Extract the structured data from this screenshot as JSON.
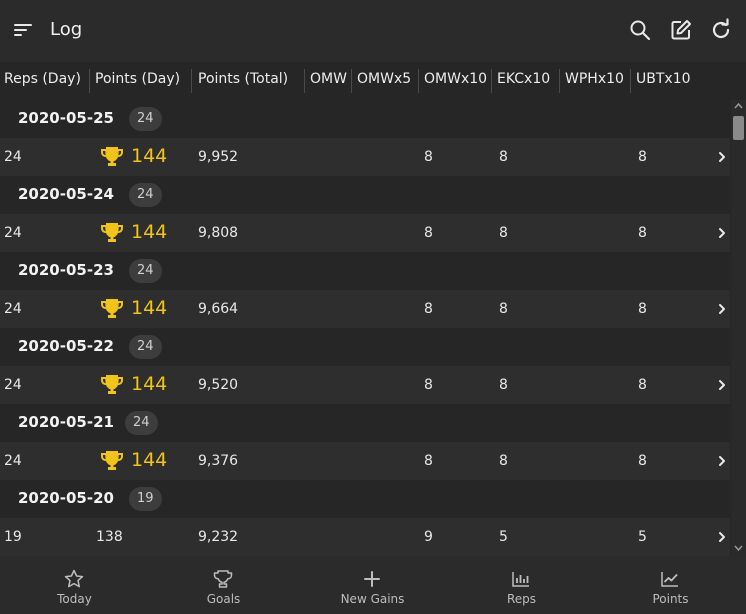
{
  "appbar": {
    "title": "Log",
    "icons": [
      "menu-icon",
      "search-icon",
      "edit-icon",
      "refresh-icon"
    ]
  },
  "columns": [
    "Reps (Day)",
    "Points (Day)",
    "Points (Total)",
    "OMW",
    "OMWx5",
    "OMWx10",
    "EKCx10",
    "WPHx10",
    "UBTx10"
  ],
  "groups": [
    {
      "date": "2020-05-25",
      "count": "24",
      "row": {
        "reps": "24",
        "points_day": "144",
        "trophy": true,
        "points_total": "9,952",
        "omwx10": "8",
        "ekcx10": "8",
        "ubtx10": "8"
      }
    },
    {
      "date": "2020-05-24",
      "count": "24",
      "row": {
        "reps": "24",
        "points_day": "144",
        "trophy": true,
        "points_total": "9,808",
        "omwx10": "8",
        "ekcx10": "8",
        "ubtx10": "8"
      }
    },
    {
      "date": "2020-05-23",
      "count": "24",
      "row": {
        "reps": "24",
        "points_day": "144",
        "trophy": true,
        "points_total": "9,664",
        "omwx10": "8",
        "ekcx10": "8",
        "ubtx10": "8"
      }
    },
    {
      "date": "2020-05-22",
      "count": "24",
      "row": {
        "reps": "24",
        "points_day": "144",
        "trophy": true,
        "points_total": "9,520",
        "omwx10": "8",
        "ekcx10": "8",
        "ubtx10": "8"
      }
    },
    {
      "date": "2020-05-21",
      "count": "24",
      "row": {
        "reps": "24",
        "points_day": "144",
        "trophy": true,
        "points_total": "9,376",
        "omwx10": "8",
        "ekcx10": "8",
        "ubtx10": "8"
      }
    },
    {
      "date": "2020-05-20",
      "count": "19",
      "row": {
        "reps": "19",
        "points_day": "138",
        "trophy": false,
        "points_total": "9,232",
        "omwx10": "9",
        "ekcx10": "5",
        "ubtx10": "5"
      }
    }
  ],
  "nav": [
    {
      "label": "Today",
      "icon": "star-icon"
    },
    {
      "label": "Goals",
      "icon": "trophy-icon"
    },
    {
      "label": "New Gains",
      "icon": "plus-icon"
    },
    {
      "label": "Reps",
      "icon": "bar-chart-icon"
    },
    {
      "label": "Points",
      "icon": "line-chart-icon"
    }
  ],
  "colors": {
    "accent_gold": "#f0c419",
    "background": "#262626",
    "row_bg": "#2e2e2e",
    "badge_bg": "#3d3d3d"
  }
}
